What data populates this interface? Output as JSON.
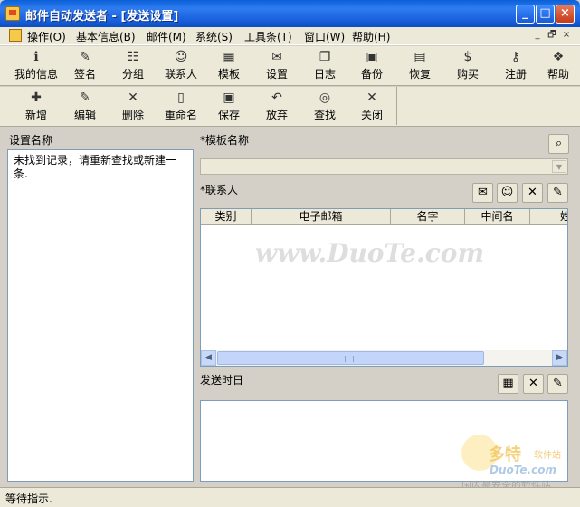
{
  "window": {
    "title": "邮件自动发送者 - [发送设置]",
    "controls": [
      "_",
      "□",
      "×"
    ]
  },
  "menu": {
    "items": [
      "操作(O)",
      "基本信息(B)",
      "邮件(M)",
      "系统(S)",
      "工具条(T)",
      "窗口(W)",
      "帮助(H)"
    ],
    "mdi_controls": [
      "_",
      "🗗",
      "×"
    ]
  },
  "toolbar_main": [
    {
      "label": "我的信息",
      "icon": "info-icon",
      "glyph": "ℹ"
    },
    {
      "label": "签名",
      "icon": "pen-icon",
      "glyph": "✎"
    },
    {
      "label": "分组",
      "icon": "group-icon",
      "glyph": "☷"
    },
    {
      "label": "联系人",
      "icon": "contact-icon",
      "glyph": "☺"
    },
    {
      "label": "模板",
      "icon": "template-icon",
      "glyph": "▦"
    },
    {
      "label": "设置",
      "icon": "settings-icon",
      "glyph": "✉"
    },
    {
      "label": "日志",
      "icon": "log-icon",
      "glyph": "❐"
    },
    {
      "label": "备份",
      "icon": "backup-icon",
      "glyph": "▣"
    },
    {
      "label": "恢复",
      "icon": "restore-icon",
      "glyph": "▤"
    },
    {
      "label": "购买",
      "icon": "buy-icon",
      "glyph": "$"
    },
    {
      "label": "注册",
      "icon": "key-icon",
      "glyph": "⚷"
    },
    {
      "label": "帮助",
      "icon": "help-book-icon",
      "glyph": "❖"
    }
  ],
  "toolbar_edit": [
    {
      "label": "新增",
      "icon": "add-icon",
      "glyph": "✚"
    },
    {
      "label": "编辑",
      "icon": "edit-icon",
      "glyph": "✎"
    },
    {
      "label": "删除",
      "icon": "delete-icon",
      "glyph": "✕"
    },
    {
      "label": "重命名",
      "icon": "rename-icon",
      "glyph": "▯"
    },
    {
      "label": "保存",
      "icon": "save-icon",
      "glyph": "▣"
    },
    {
      "label": "放弃",
      "icon": "undo-icon",
      "glyph": "↶"
    },
    {
      "label": "查找",
      "icon": "binoculars-icon",
      "glyph": "◎"
    },
    {
      "label": "关闭",
      "icon": "close-icon",
      "glyph": "✕"
    }
  ],
  "left_panel": {
    "label": "设置名称",
    "message": "未找到记录，请重新查找或新建一条."
  },
  "right_panel": {
    "template_label": "*模板名称",
    "template_value": "",
    "contacts_label": "*联系人",
    "contacts_columns": [
      "类别",
      "电子邮箱",
      "名字",
      "中间名",
      "姓"
    ],
    "send_date_label": "发送时日"
  },
  "watermark": {
    "text": "www.DuoTe.com",
    "logo_text": "多特",
    "logo_sub": "软件站",
    "logo_url": "DuoTe.com",
    "tagline": "国内最安全的软件站"
  },
  "status": {
    "text": "等待指示."
  }
}
